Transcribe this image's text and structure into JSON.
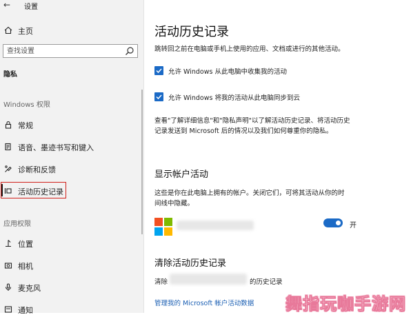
{
  "app": {
    "title": "设置"
  },
  "sidebar": {
    "home_label": "主页",
    "search_placeholder": "查找设置",
    "section_title": "隐私",
    "group_windows": "Windows 权限",
    "group_app": "应用权限",
    "windows_items": [
      {
        "label": "常规",
        "icon": "lock-icon"
      },
      {
        "label": "语音、墨迹书写和键入",
        "icon": "pen-document-icon"
      },
      {
        "label": "诊断和反馈",
        "icon": "feedback-icon"
      },
      {
        "label": "活动历史记录",
        "icon": "timeline-icon",
        "selected": true
      }
    ],
    "app_items": [
      {
        "label": "位置",
        "icon": "location-icon"
      },
      {
        "label": "相机",
        "icon": "camera-icon"
      },
      {
        "label": "麦克风",
        "icon": "microphone-icon"
      },
      {
        "label": "通知",
        "icon": "notification-icon"
      }
    ]
  },
  "main": {
    "title": "活动历史记录",
    "intro": "跳转回之前在电脑或手机上使用的应用、文档或进行的其他活动。",
    "checkbox1": {
      "label": "允许 Windows 从此电脑中收集我的活动",
      "checked": true
    },
    "checkbox2": {
      "label": "允许 Windows 将我的活动从此电脑同步到云",
      "checked": true
    },
    "privacy_text_1": "查看\"了解详细信息\"和\"隐私声明\"以了解活动历史记录、将活动历史",
    "privacy_text_2": "记录发送到 Microsoft 后的情况以及我们如何尊重你的隐私。",
    "accounts_title": "显示帐户活动",
    "accounts_text_1": "这些是你在此电脑上拥有的帐户。关闭它们，可将其活动从你的时",
    "accounts_text_2": "间线中隐藏。",
    "toggle": {
      "state": "on",
      "label": "开"
    },
    "clear_title": "清除活动历史记录",
    "clear_text_prefix": "清除",
    "clear_text_suffix": "的历史记录",
    "manage_link": "管理我的 Microsoft 帐户活动数据"
  },
  "watermark": "舞指玩咖手游网",
  "colors": {
    "accent": "#1b6ac6",
    "selection_outline": "#d0201a",
    "link": "#1b5fb3"
  }
}
